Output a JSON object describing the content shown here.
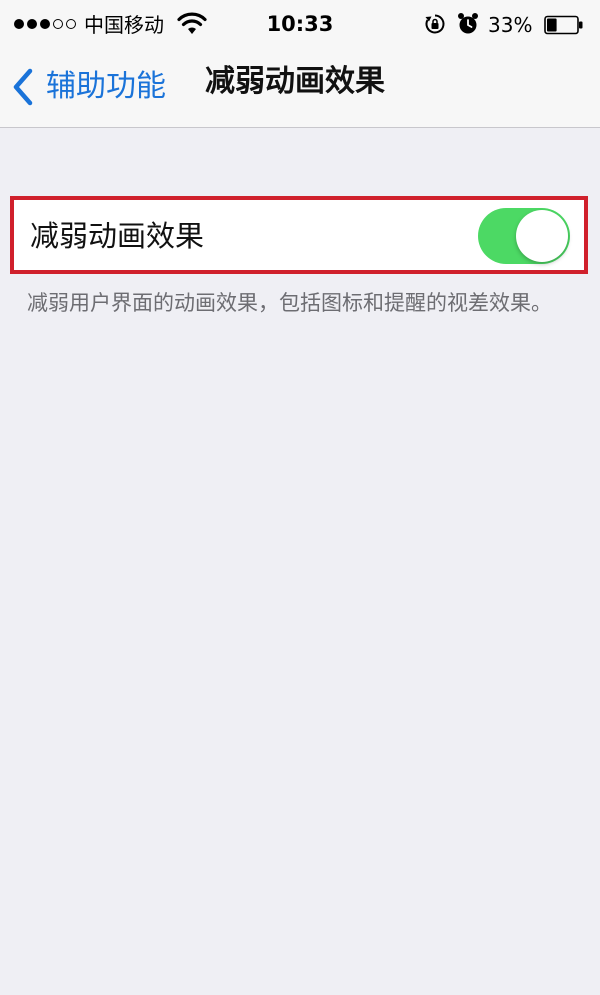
{
  "status_bar": {
    "signal_strength": "3 of 5",
    "carrier": "中国移动",
    "time": "10:33",
    "battery_percent": "33%",
    "battery_level": 0.33,
    "icons": [
      "signal-dots-icon",
      "wifi-icon",
      "rotation-lock-icon",
      "alarm-icon",
      "battery-icon"
    ]
  },
  "nav": {
    "back_label": "辅助功能",
    "title": "减弱动画效果"
  },
  "setting": {
    "label": "减弱动画效果",
    "toggle_on": true
  },
  "footer": {
    "description": "减弱用户界面的动画效果，包括图标和提醒的视差效果。"
  },
  "colors": {
    "accent": "#1a73d9",
    "toggle_on": "#4cd964",
    "highlight_border": "#d0202c",
    "background": "#efeff4",
    "footer_text": "#6d6d72"
  }
}
